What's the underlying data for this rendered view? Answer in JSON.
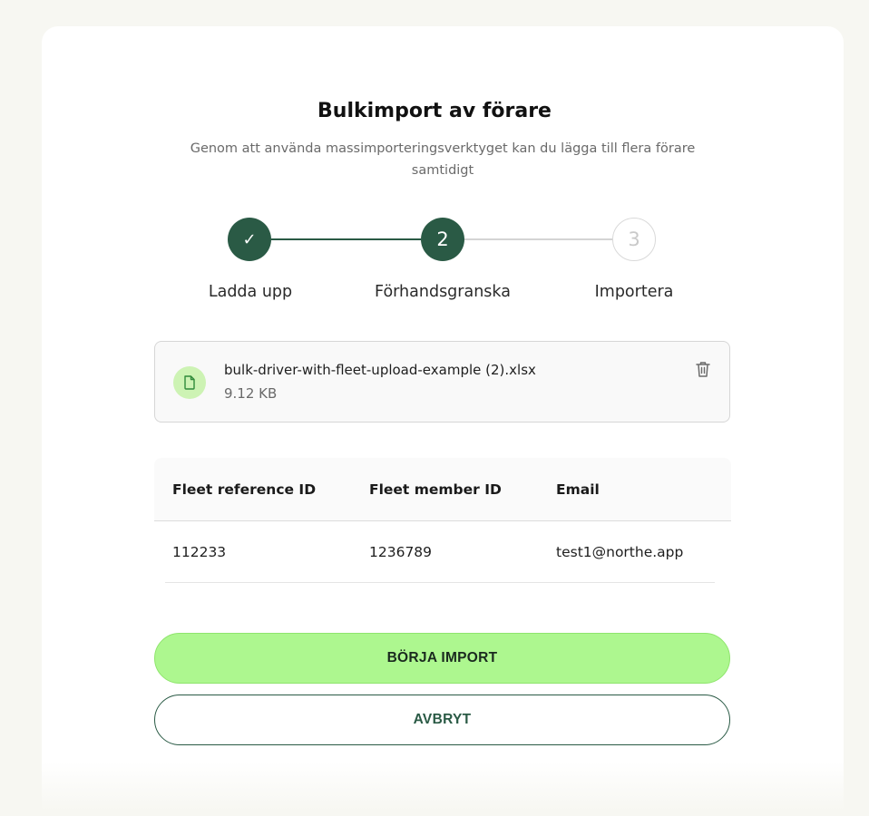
{
  "header": {
    "title": "Bulkimport av förare",
    "subtitle": "Genom att använda massimporteringsverktyget kan du lägga till flera förare samtidigt"
  },
  "stepper": {
    "steps": [
      {
        "label": "Ladda upp",
        "marker": "✓",
        "state": "completed"
      },
      {
        "label": "Förhandsgranska",
        "marker": "2",
        "state": "active"
      },
      {
        "label": "Importera",
        "marker": "3",
        "state": "pending"
      }
    ],
    "colors": {
      "active": "#2a5a45",
      "pending": "#d4d4d4"
    }
  },
  "file": {
    "name": "bulk-driver-with-fleet-upload-example (2).xlsx",
    "size": "9.12 KB",
    "icon": "file-icon",
    "delete_icon": "trash-icon"
  },
  "table": {
    "headers": [
      "Fleet reference ID",
      "Fleet member ID",
      "Email"
    ],
    "rows": [
      [
        "112233",
        "1236789",
        "test1@northe.app"
      ]
    ]
  },
  "actions": {
    "start_import": "BÖRJA IMPORT",
    "cancel": "AVBRYT"
  },
  "colors": {
    "primary_button": "#adf78f",
    "brand_dark_green": "#2a5a45"
  }
}
